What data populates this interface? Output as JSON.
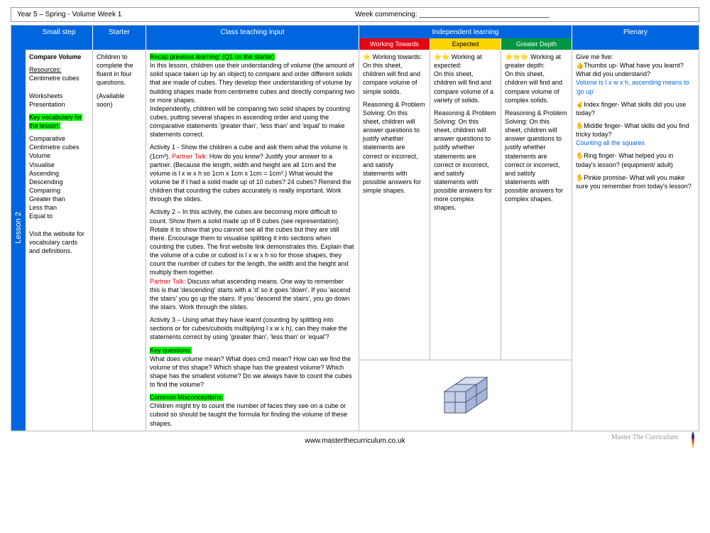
{
  "doc": {
    "title": "Year 5 – Spring - Volume Week 1",
    "week_label": "Week commencing: _________________________________"
  },
  "lesson_tab": "Lesson 2",
  "headers": {
    "small_step": "Small step",
    "starter": "Starter",
    "teaching": "Class teaching input",
    "independent": "Independent learning",
    "plenary": "Plenary",
    "wt": "Working Towards",
    "exp": "Expected",
    "gd": "Greater Depth"
  },
  "small_step": {
    "title": "Compare Volume",
    "resources_label": "Resources:",
    "resource1": "Centimetre cubes",
    "resource2": "Worksheets",
    "resource3": "Presentation",
    "vocab_label": "Key vocabulary for the lesson:",
    "vocab": "Comparative\nCentimetre cubes\nVolume\nVisualise\nAscending\nDescending\nComparing\nGreater than\nLess than\nEqual to",
    "footer": "Visit the website for vocabulary cards and definitions."
  },
  "starter": {
    "text": "Children to complete the fluent in four questions.",
    "avail": "(Available soon)"
  },
  "teaching": {
    "recap_label": "Recap previous learning: (Q1 on the starter)",
    "recap": "In this lesson, children use their understanding of volume (the amount of solid space taken up by an object) to compare and order different solids that are made of cubes. They develop their understanding of volume by building shapes made from centimetre cubes and directly comparing two or more shapes.\nIndependently, children will be comparing two solid shapes by counting cubes, putting several shapes in ascending order and using the comparative statements 'greater than', 'less than' and 'equal' to make statements correct.",
    "act1a": "Activity 1 - Show the children a cube and ask them what the volume is (1cm³). ",
    "pt_label": "Partner Talk:",
    "act1b": " How do you know? Justify your answer to a partner. (Because the length, width and height are all 1cm and the volume is l x w x h so 1cm x 1cm x 1cm = 1cm³.) What would the volume be if I had a solid made up of 10 cubes? 24 cubes? Remind the children that counting the cubes accurately is really important. Work through the slides.",
    "act2": "Activity 2 – In this activity, the cubes are becoming more difficult to count. Show them a solid made up of 8 cubes (see representation). Rotate it to show that you cannot see all the cubes but they are still there. Encourage them to visualise splitting it into sections when counting the cubes. The first website link demonstrates this. Explain that the volume of a cube or cuboid is l x w x h so for those shapes, they count the number of cubes for the length, the width and the height and multiply them together.",
    "pt2": " Discuss what ascending means. One way to remember this is that 'descending' starts with a 'd' so it goes 'down'. If you 'ascend the stairs' you go up the stairs. If you 'descend the stairs', you go down the stairs. Work through the slides.",
    "act3": "Activity 3 – Using what they have learnt (counting by splitting into sections or for cubes/cuboids multiplying l x w x h), can they make the statements correct by using 'greater than', 'less than' or 'equal'?",
    "kq_label": "Key questions:",
    "kq": "What does volume mean? What does cm3 mean? How can we find the volume of this shape? Which shape has the greatest volume? Which shape has the smallest volume? Do we always have to count the cubes to find the volume?",
    "cm_label": "Common Misconceptions:",
    "cm": "Children might try to count the number of faces they see on a cube or cuboid so should be taught the formula for finding the volume of these shapes."
  },
  "wt": {
    "star": "⭐",
    "title": " Working towards:",
    "p1": "On this sheet, children will find and compare volume of simple solids.",
    "p2": "Reasoning & Problem Solving: On this sheet, children will answer questions to justify whether statements are correct or incorrect, and satisfy statements with possible answers for simple shapes."
  },
  "exp": {
    "star": "⭐⭐",
    "title": " Working at expected:",
    "p1": "On this sheet, children will find and compare volume of a variety of solids.",
    "p2": "Reasoning & Problem Solving: On this sheet, children will answer questions to justify whether statements are correct or incorrect, and satisfy statements with possible answers for more complex shapes."
  },
  "gd": {
    "star": "⭐⭐⭐",
    "title": " Working at greater depth:",
    "p1": "On this sheet, children will find and compare volume of complex solids.",
    "p2": "Reasoning & Problem Solving: On this sheet, children will answer questions to justify whether statements are correct or incorrect, and satisfy statements with possible answers for complex shapes."
  },
  "plenary": {
    "intro": "Give me five:",
    "thumb_icon": "👍",
    "thumb": "Thumbs up- What have you learnt? What did you understand?",
    "thumb_ans": "Volume is l x w x h, ascending means to 'go up'",
    "index_icon": "☝",
    "index": "Index finger- What skills did you use today?",
    "middle_icon": "✋",
    "middle": "Middle finger- What skills did you find tricky today?",
    "middle_ans": "Counting all the squares",
    "ring_icon": "✋",
    "ring": "Ring finger- What helped you in today's lesson? (equipment/ adult)",
    "pinkie_icon": "✋",
    "pinkie": "Pinkie promise- What will you make sure you remember from today's lesson?"
  },
  "footer": {
    "url": "www.masterthecurriculum.co.uk",
    "script": "Master The Curriculum"
  }
}
